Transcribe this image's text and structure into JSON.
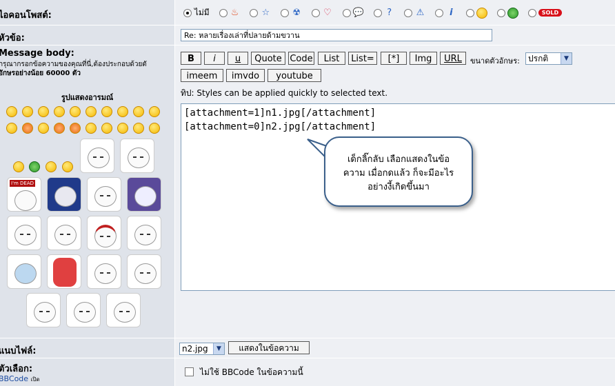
{
  "form": {
    "icon_row": {
      "label": "ไอคอนโพสต์:",
      "none_label": "ไม่มี",
      "icons": [
        "fire-icon",
        "star-icon",
        "radioactive-icon",
        "heart-icon",
        "speech-bubble-icon",
        "question-icon",
        "warning-icon",
        "info-icon",
        "lightbulb-icon",
        "grin-icon",
        "sold-icon"
      ],
      "sold_text": "SOLD"
    },
    "subject_row": {
      "label": "หัวข้อ:",
      "value": "Re: หลายเรื่องเล่าที่ปลายด้ามขวาน"
    },
    "body_row": {
      "label": "Message body:",
      "hint_line1": "กรุณากรอกข้อความของคุณที่นี่,ต้องประกอบด้วยตั",
      "hint_line2": "อักษรอย่างน้อย 60000 ตัว",
      "smilies_title": "รูปแสดงอารมณ์",
      "toolbar": [
        "B",
        "i",
        "u",
        "Quote",
        "Code",
        "List",
        "List=",
        "[*]",
        "Img",
        "URL"
      ],
      "toolbar2": [
        "imeem",
        "imvdo",
        "youtube"
      ],
      "font_size_label": "ขนาดตัวอักษร:",
      "font_size_value": "ปรกติ",
      "tip": "ทิป: Styles can be applied quickly to selected text.",
      "content_line1": "[attachment=1]n1.jpg[/attachment]",
      "content_line2": "[attachment=0]n2.jpg[/attachment]",
      "callout_line1": "เด็กลิ๊กลับ เลือกแสดงในข้อ",
      "callout_line2": "ความ เมื่อกดแล้ว ก็จะมีอะไร",
      "callout_line3": "อย่างงี้เกิดขึ้นมา"
    },
    "attach_row": {
      "label": "แนบไฟล์:",
      "file_value": "n2.jpg",
      "show_button": "แสดงในข้อความ"
    },
    "options_row": {
      "label": "ตัวเลือก:",
      "bbcode_link": "BBCode",
      "bbcode_suffix": "เปิด",
      "opt1": "ไม่ใช้ BBCode ในข้อความนี้"
    }
  }
}
